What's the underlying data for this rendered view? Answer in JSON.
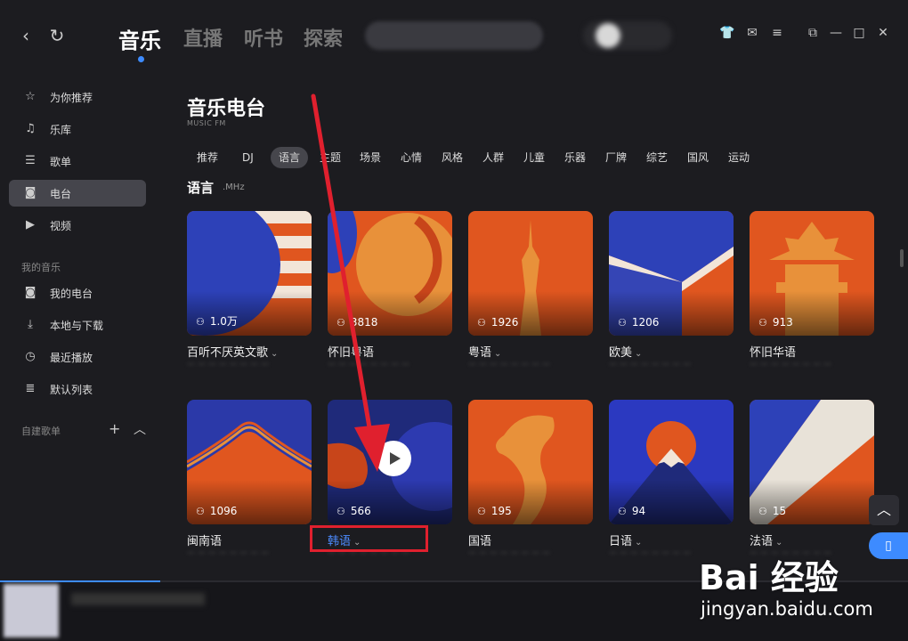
{
  "header": {
    "tabs": [
      "音乐",
      "直播",
      "听书",
      "探索"
    ],
    "active_tab": "音乐"
  },
  "sidebar": {
    "items": [
      {
        "label": "为你推荐",
        "icon": "star-icon"
      },
      {
        "label": "乐库",
        "icon": "music-note-icon"
      },
      {
        "label": "歌单",
        "icon": "playlist-icon"
      },
      {
        "label": "电台",
        "icon": "radio-icon"
      },
      {
        "label": "视频",
        "icon": "video-icon"
      }
    ],
    "my_music_heading": "我的音乐",
    "my_items": [
      {
        "label": "我的电台",
        "icon": "radio-icon"
      },
      {
        "label": "本地与下载",
        "icon": "download-icon"
      },
      {
        "label": "最近播放",
        "icon": "clock-icon"
      },
      {
        "label": "默认列表",
        "icon": "list-icon"
      }
    ],
    "custom_heading": "自建歌单"
  },
  "main": {
    "title": "音乐电台",
    "subtitle": "MUSIC FM",
    "categories": [
      "推荐",
      "DJ",
      "语言",
      "主题",
      "场景",
      "心情",
      "风格",
      "人群",
      "儿童",
      "乐器",
      "厂牌",
      "综艺",
      "国风",
      "运动"
    ],
    "active_category": "语言",
    "section_title": "语言",
    "section_sub": ".MHz",
    "cards": [
      {
        "name": "百听不厌英文歌",
        "count": "1.0万",
        "has_dropdown": true
      },
      {
        "name": "怀旧粤语",
        "count": "3818",
        "has_dropdown": false
      },
      {
        "name": "粤语",
        "count": "1926",
        "has_dropdown": true
      },
      {
        "name": "欧美",
        "count": "1206",
        "has_dropdown": true
      },
      {
        "name": "怀旧华语",
        "count": "913",
        "has_dropdown": false
      },
      {
        "name": "闽南语",
        "count": "1096",
        "has_dropdown": false
      },
      {
        "name": "韩语",
        "count": "566",
        "has_dropdown": true
      },
      {
        "name": "国语",
        "count": "195",
        "has_dropdown": false
      },
      {
        "name": "日语",
        "count": "94",
        "has_dropdown": true
      },
      {
        "name": "法语",
        "count": "15",
        "has_dropdown": true
      }
    ]
  },
  "watermark": {
    "logo": "Bai 经验",
    "url": "jingyan.baidu.com"
  },
  "colors": {
    "accent": "#3d8bff",
    "annotation_red": "#e0202e",
    "card_orange": "#e0561f",
    "card_blue": "#2b39a8"
  }
}
